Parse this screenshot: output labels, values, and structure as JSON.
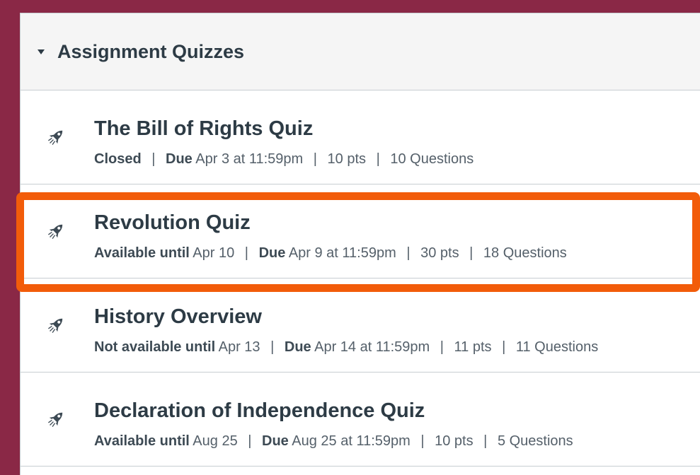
{
  "group": {
    "title": "Assignment Quizzes"
  },
  "quizzes": [
    {
      "title": "The Bill of Rights Quiz",
      "availability_label": "Closed",
      "availability_value": "",
      "due_label": "Due",
      "due_value": "Apr 3 at 11:59pm",
      "points": "10 pts",
      "questions": "10 Questions"
    },
    {
      "title": "Revolution Quiz",
      "availability_label": "Available until",
      "availability_value": "Apr 10",
      "due_label": "Due",
      "due_value": "Apr 9 at 11:59pm",
      "points": "30 pts",
      "questions": "18 Questions"
    },
    {
      "title": "History Overview",
      "availability_label": "Not available until",
      "availability_value": "Apr 13",
      "due_label": "Due",
      "due_value": "Apr 14 at 11:59pm",
      "points": "11 pts",
      "questions": "11 Questions"
    },
    {
      "title": "Declaration of Independence Quiz",
      "availability_label": "Available until",
      "availability_value": "Aug 25",
      "due_label": "Due",
      "due_value": "Aug 25 at 11:59pm",
      "points": "10 pts",
      "questions": "5 Questions"
    }
  ],
  "colors": {
    "background": "#8a2846",
    "highlight": "#f25c0a",
    "text_primary": "#2d3b45",
    "text_secondary": "#55606a"
  },
  "icons": {
    "quiz": "rocket-icon",
    "collapse": "caret-down-icon"
  },
  "highlighted_row": 1
}
